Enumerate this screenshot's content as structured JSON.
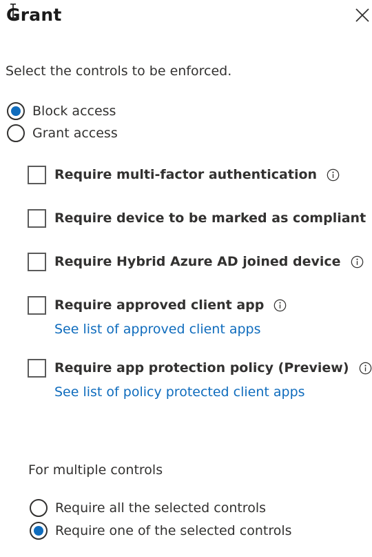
{
  "panel": {
    "title": "Grant",
    "subtitle": "Select the controls to be enforced."
  },
  "access": {
    "options": [
      {
        "label": "Block access",
        "selected": true
      },
      {
        "label": "Grant access",
        "selected": false
      }
    ]
  },
  "controls": [
    {
      "label": "Require multi-factor authentication",
      "checked": false
    },
    {
      "label": "Require device to be marked as compliant",
      "checked": false
    },
    {
      "label": "Require Hybrid Azure AD joined device",
      "checked": false
    },
    {
      "label": "Require approved client app",
      "checked": false,
      "link": "See list of approved client apps"
    },
    {
      "label": "Require app protection policy (Preview)",
      "checked": false,
      "link": "See list of policy protected client apps"
    }
  ],
  "multiple": {
    "label": "For multiple controls",
    "options": [
      {
        "label": "Require all the selected controls",
        "selected": false
      },
      {
        "label": "Require one of the selected controls",
        "selected": true
      }
    ]
  },
  "colors": {
    "accent": "#0f6cbd",
    "text": "#323130"
  },
  "icons": {
    "close": "close-icon",
    "info": "info-icon",
    "cursor": "text-cursor-icon"
  }
}
